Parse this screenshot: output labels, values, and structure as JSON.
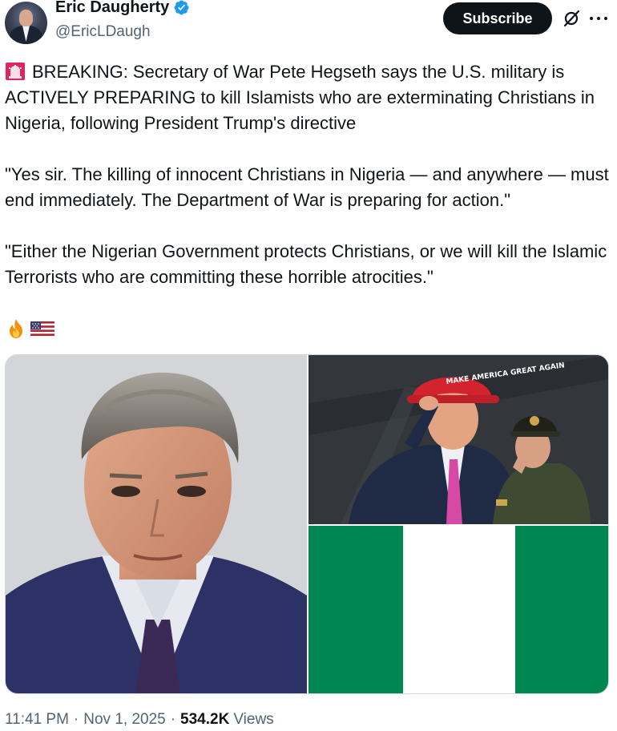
{
  "author": {
    "display_name": "Eric Daugherty",
    "handle": "@EricLDaugh",
    "verified": true,
    "avatar": "profile-photo"
  },
  "actions": {
    "subscribe_label": "Subscribe",
    "grok_icon": "grok-icon",
    "more_icon": "more-icon"
  },
  "tweet": {
    "line1_prefix_icon": "siren-icon",
    "paragraph1": "BREAKING: Secretary of War Pete Hegseth says the U.S. military is ACTIVELY PREPARING to kill Islamists who are exterminating Christians in Nigeria, following President Trump's directive",
    "paragraph2": "\"Yes sir. The killing of innocent Christians in Nigeria — and anywhere — must end immediately. The Department of War is preparing for action.\"",
    "paragraph3": "\"Either the Nigerian Government protects Christians, or we will kill the Islamic Terrorists who are committing these horrible atrocities.\"",
    "emojis": [
      "fire-icon",
      "us-flag-icon"
    ]
  },
  "media": {
    "image1": "portrait-photo",
    "image2": "salute-photo",
    "image2_cap_text": "MAKE AMERICA GREAT AGAIN",
    "image3": "nigeria-flag"
  },
  "meta": {
    "time": "11:41 PM",
    "date": "Nov 1, 2025",
    "views_count": "534.2K",
    "views_label": "Views",
    "separator": "·"
  },
  "colors": {
    "text": "#0f1419",
    "secondary": "#536471",
    "verified": "#1d9bf0",
    "nigeria_green": "#008751"
  }
}
